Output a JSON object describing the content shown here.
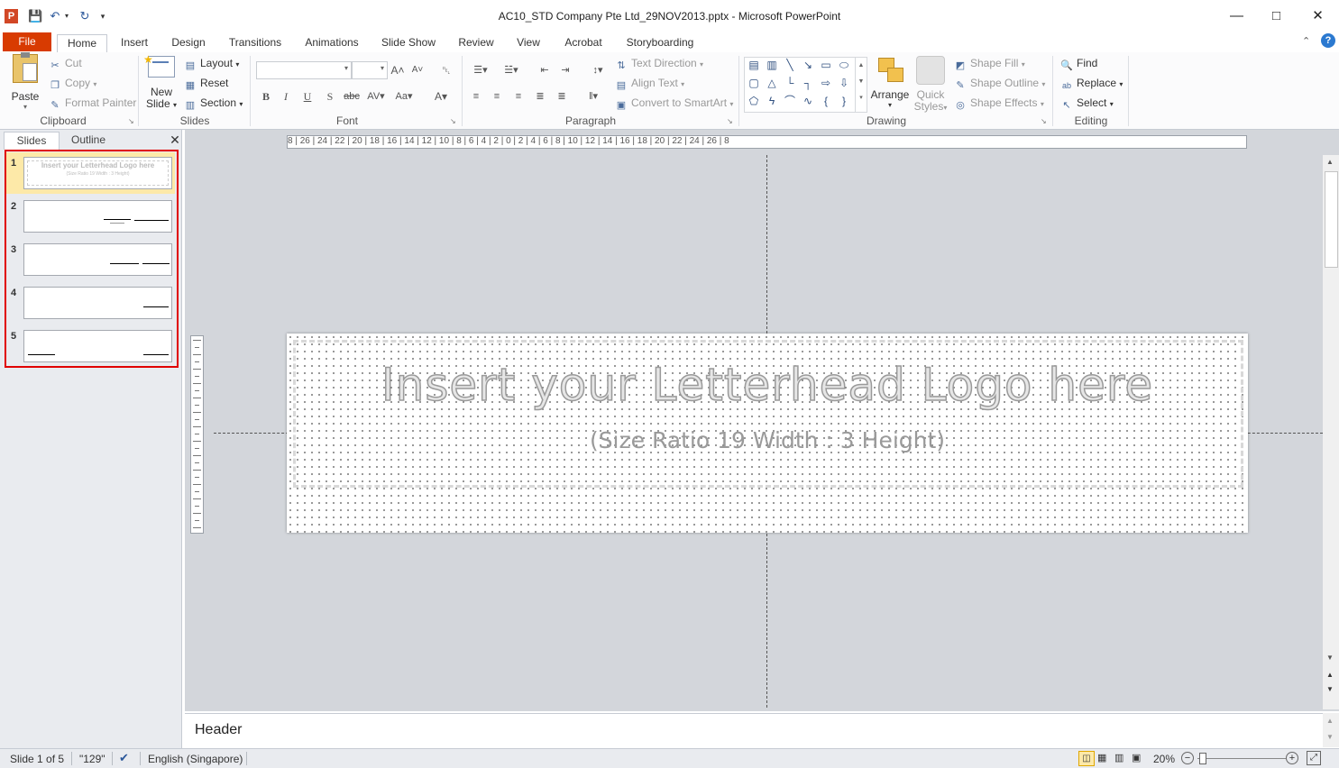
{
  "window": {
    "title": "AC10_STD Company Pte Ltd_29NOV2013.pptx  -  Microsoft PowerPoint",
    "app_icon": "P"
  },
  "tabs": {
    "file": "File",
    "items": [
      "Home",
      "Insert",
      "Design",
      "Transitions",
      "Animations",
      "Slide Show",
      "Review",
      "View",
      "Acrobat",
      "Storyboarding"
    ]
  },
  "ribbon": {
    "clipboard": {
      "label": "Clipboard",
      "paste": "Paste",
      "cut": "Cut",
      "copy": "Copy",
      "format_painter": "Format Painter"
    },
    "slides": {
      "label": "Slides",
      "new_slide_1": "New",
      "new_slide_2": "Slide",
      "layout": "Layout",
      "reset": "Reset",
      "section": "Section"
    },
    "font": {
      "label": "Font"
    },
    "paragraph": {
      "label": "Paragraph",
      "text_direction": "Text Direction",
      "align_text": "Align Text",
      "convert_smartart": "Convert to SmartArt"
    },
    "drawing": {
      "label": "Drawing",
      "arrange": "Arrange",
      "quick_styles_1": "Quick",
      "quick_styles_2": "Styles",
      "shape_fill": "Shape Fill",
      "shape_outline": "Shape Outline",
      "shape_effects": "Shape Effects"
    },
    "editing": {
      "label": "Editing",
      "find": "Find",
      "replace": "Replace",
      "select": "Select"
    }
  },
  "left_pane": {
    "tab_slides": "Slides",
    "tab_outline": "Outline",
    "thumbs": [
      {
        "num": "1",
        "title": "Insert your Letterhead Logo here",
        "sub": "(Size Ratio 19 Width : 3 Height)"
      },
      {
        "num": "2"
      },
      {
        "num": "3"
      },
      {
        "num": "4"
      },
      {
        "num": "5"
      }
    ]
  },
  "ruler": {
    "text": "8 | 26 | 24 | 22 | 20 | 18 | 16 | 14 | 12 | 10 | 8 | 6 | 4 | 2 | 0 | 2 | 4 | 6 | 8 | 10 | 12 | 14 | 16 | 18 | 20 | 22 | 24 | 26 | 8"
  },
  "slide": {
    "title": "Insert your Letterhead Logo here",
    "subtitle": "(Size Ratio 19 Width : 3 Height)"
  },
  "notes": {
    "text": "Header"
  },
  "status": {
    "slide_of": "Slide 1 of 5",
    "theme": "\"129\"",
    "language": "English (Singapore)",
    "zoom": "20%"
  },
  "colors": {
    "file_tab": "#d83b01",
    "selection": "#e00000",
    "selected_thumb": "#fde9a8"
  }
}
